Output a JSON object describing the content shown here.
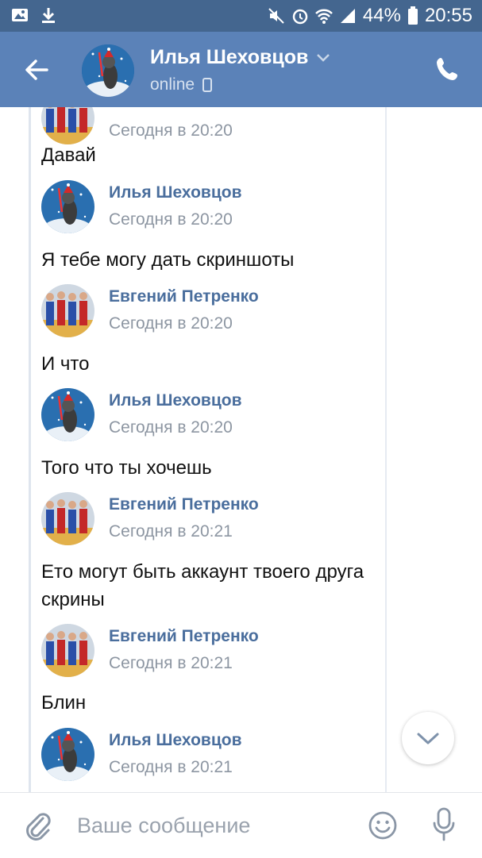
{
  "status_bar": {
    "battery": "44%",
    "time": "20:55",
    "icons": [
      "image-icon",
      "download-icon",
      "mute-icon",
      "alarm-icon",
      "wifi-icon",
      "signal-icon",
      "battery-icon"
    ]
  },
  "header": {
    "contact_name": "Илья Шеховцов",
    "status": "online",
    "icons": [
      "back-arrow-icon",
      "chevron-down-icon",
      "phone-device-icon",
      "call-icon"
    ],
    "colors": {
      "status_bar": "#44668f",
      "header": "#5b82b8"
    }
  },
  "messages": [
    {
      "author": "",
      "time": "Сегодня в 20:20",
      "text": "Давай",
      "avatar": "evgeny"
    },
    {
      "author": "Илья Шеховцов",
      "time": "Сегодня в 20:20",
      "text": "Я тебе могу дать скриншоты",
      "avatar": "ilya"
    },
    {
      "author": "Евгений Петренко",
      "time": "Сегодня в 20:20",
      "text": "И что",
      "avatar": "evgeny"
    },
    {
      "author": "Илья Шеховцов",
      "time": "Сегодня в 20:20",
      "text": "Того что ты хочешь",
      "avatar": "ilya"
    },
    {
      "author": "Евгений Петренко",
      "time": "Сегодня в 20:21",
      "text": "Ето могут быть аккаунт твоего друга скрины",
      "avatar": "evgeny"
    },
    {
      "author": "Евгений Петренко",
      "time": "Сегодня в 20:21",
      "text": "Блин",
      "avatar": "evgeny"
    },
    {
      "author": "Илья Шеховцов",
      "time": "Сегодня в 20:21",
      "text": "",
      "avatar": "ilya"
    }
  ],
  "composer": {
    "placeholder": "Ваше сообщение",
    "icons": [
      "attach-icon",
      "smile-icon",
      "mic-icon"
    ]
  },
  "scroll_button": {
    "icon": "chevron-down-icon"
  }
}
